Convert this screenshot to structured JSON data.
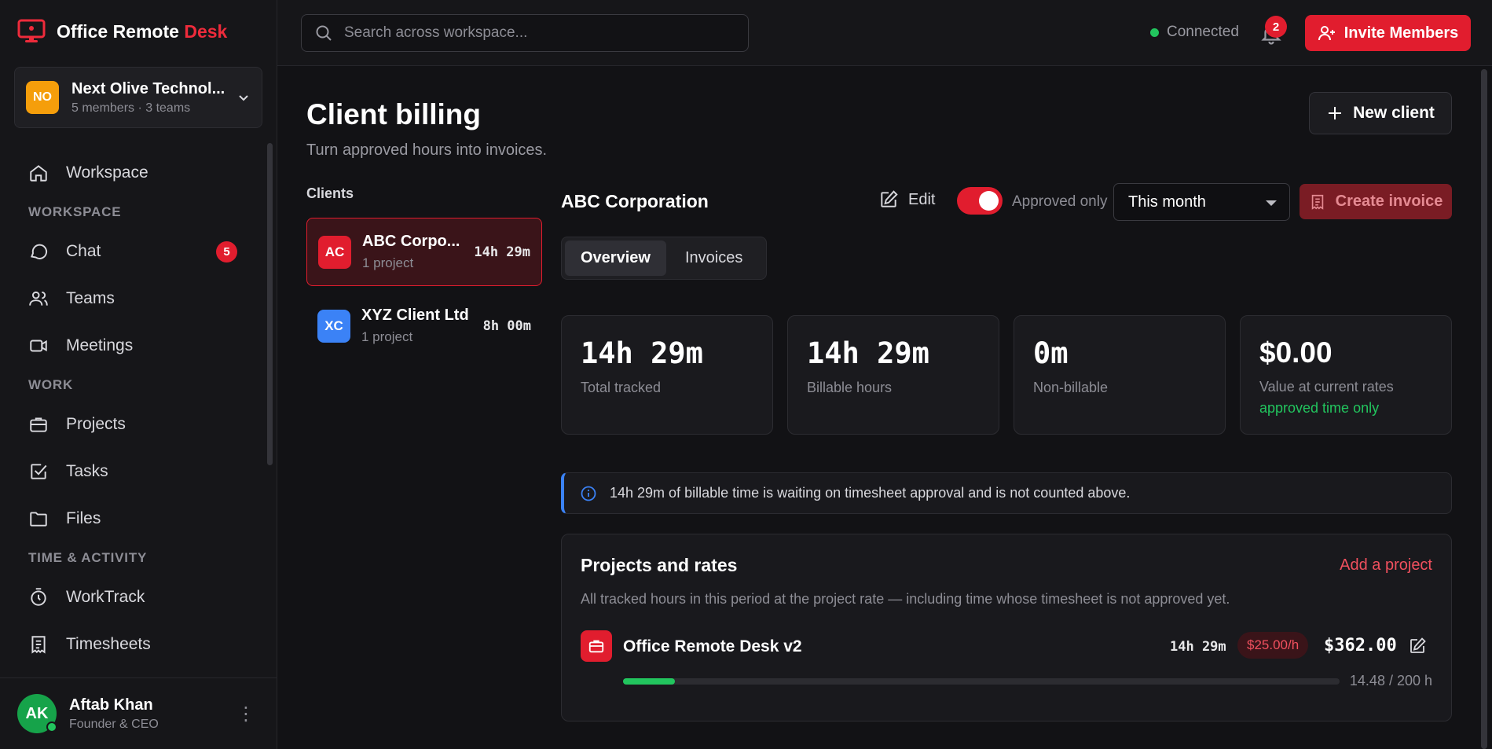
{
  "brand": {
    "name_main": "Office Remote",
    "name_accent": "Desk"
  },
  "org": {
    "initials": "NO",
    "name": "Next Olive Technol...",
    "meta": "5 members · 3 teams"
  },
  "nav": {
    "workspace": "Workspace",
    "section_workspace": "WORKSPACE",
    "chat": "Chat",
    "chat_badge": "5",
    "teams": "Teams",
    "meetings": "Meetings",
    "section_work": "WORK",
    "projects": "Projects",
    "tasks": "Tasks",
    "files": "Files",
    "section_time": "TIME & ACTIVITY",
    "worktrack": "WorkTrack",
    "timesheets": "Timesheets"
  },
  "user": {
    "initials": "AK",
    "name": "Aftab Khan",
    "role": "Founder & CEO"
  },
  "topbar": {
    "search_placeholder": "Search across workspace...",
    "status": "Connected",
    "notif_count": "2",
    "invite_label": "Invite Members"
  },
  "page": {
    "title": "Client billing",
    "subtitle": "Turn approved hours into invoices.",
    "new_client_label": "New client",
    "clients_label": "Clients"
  },
  "clients": [
    {
      "initials": "AC",
      "name": "ABC Corpo...",
      "projects": "1 project",
      "hours": "14h 29m",
      "color": "#e11d2e"
    },
    {
      "initials": "XC",
      "name": "XYZ Client Ltd",
      "projects": "1 project",
      "hours": "8h 00m",
      "color": "#3b82f6"
    }
  ],
  "detail": {
    "client_name": "ABC Corporation",
    "edit_label": "Edit",
    "approved_only_label": "Approved only",
    "approved_only": true,
    "period": "This month",
    "create_invoice_label": "Create invoice",
    "tabs": [
      "Overview",
      "Invoices"
    ]
  },
  "stats": [
    {
      "value": "14h 29m",
      "label": "Total tracked"
    },
    {
      "value": "14h 29m",
      "label": "Billable hours"
    },
    {
      "value": "0m",
      "label": "Non-billable"
    },
    {
      "value": "$0.00",
      "label": "Value at current rates",
      "note": "approved time only"
    }
  ],
  "info_banner": "14h 29m of billable time is waiting on timesheet approval and is not counted above.",
  "projects_section": {
    "title": "Projects and rates",
    "add_label": "Add a project",
    "description": "All tracked hours in this period at the project rate — including time whose timesheet is not approved yet.",
    "items": [
      {
        "name": "Office Remote Desk v2",
        "hours": "14h 29m",
        "rate": "$25.00/h",
        "amount": "$362.00",
        "cap": "14.48 / 200 h",
        "progress": 0.0724
      }
    ]
  },
  "colors": {
    "accent": "#e11d2e",
    "success": "#22c55e",
    "info": "#3b82f6",
    "background": "#121215"
  }
}
